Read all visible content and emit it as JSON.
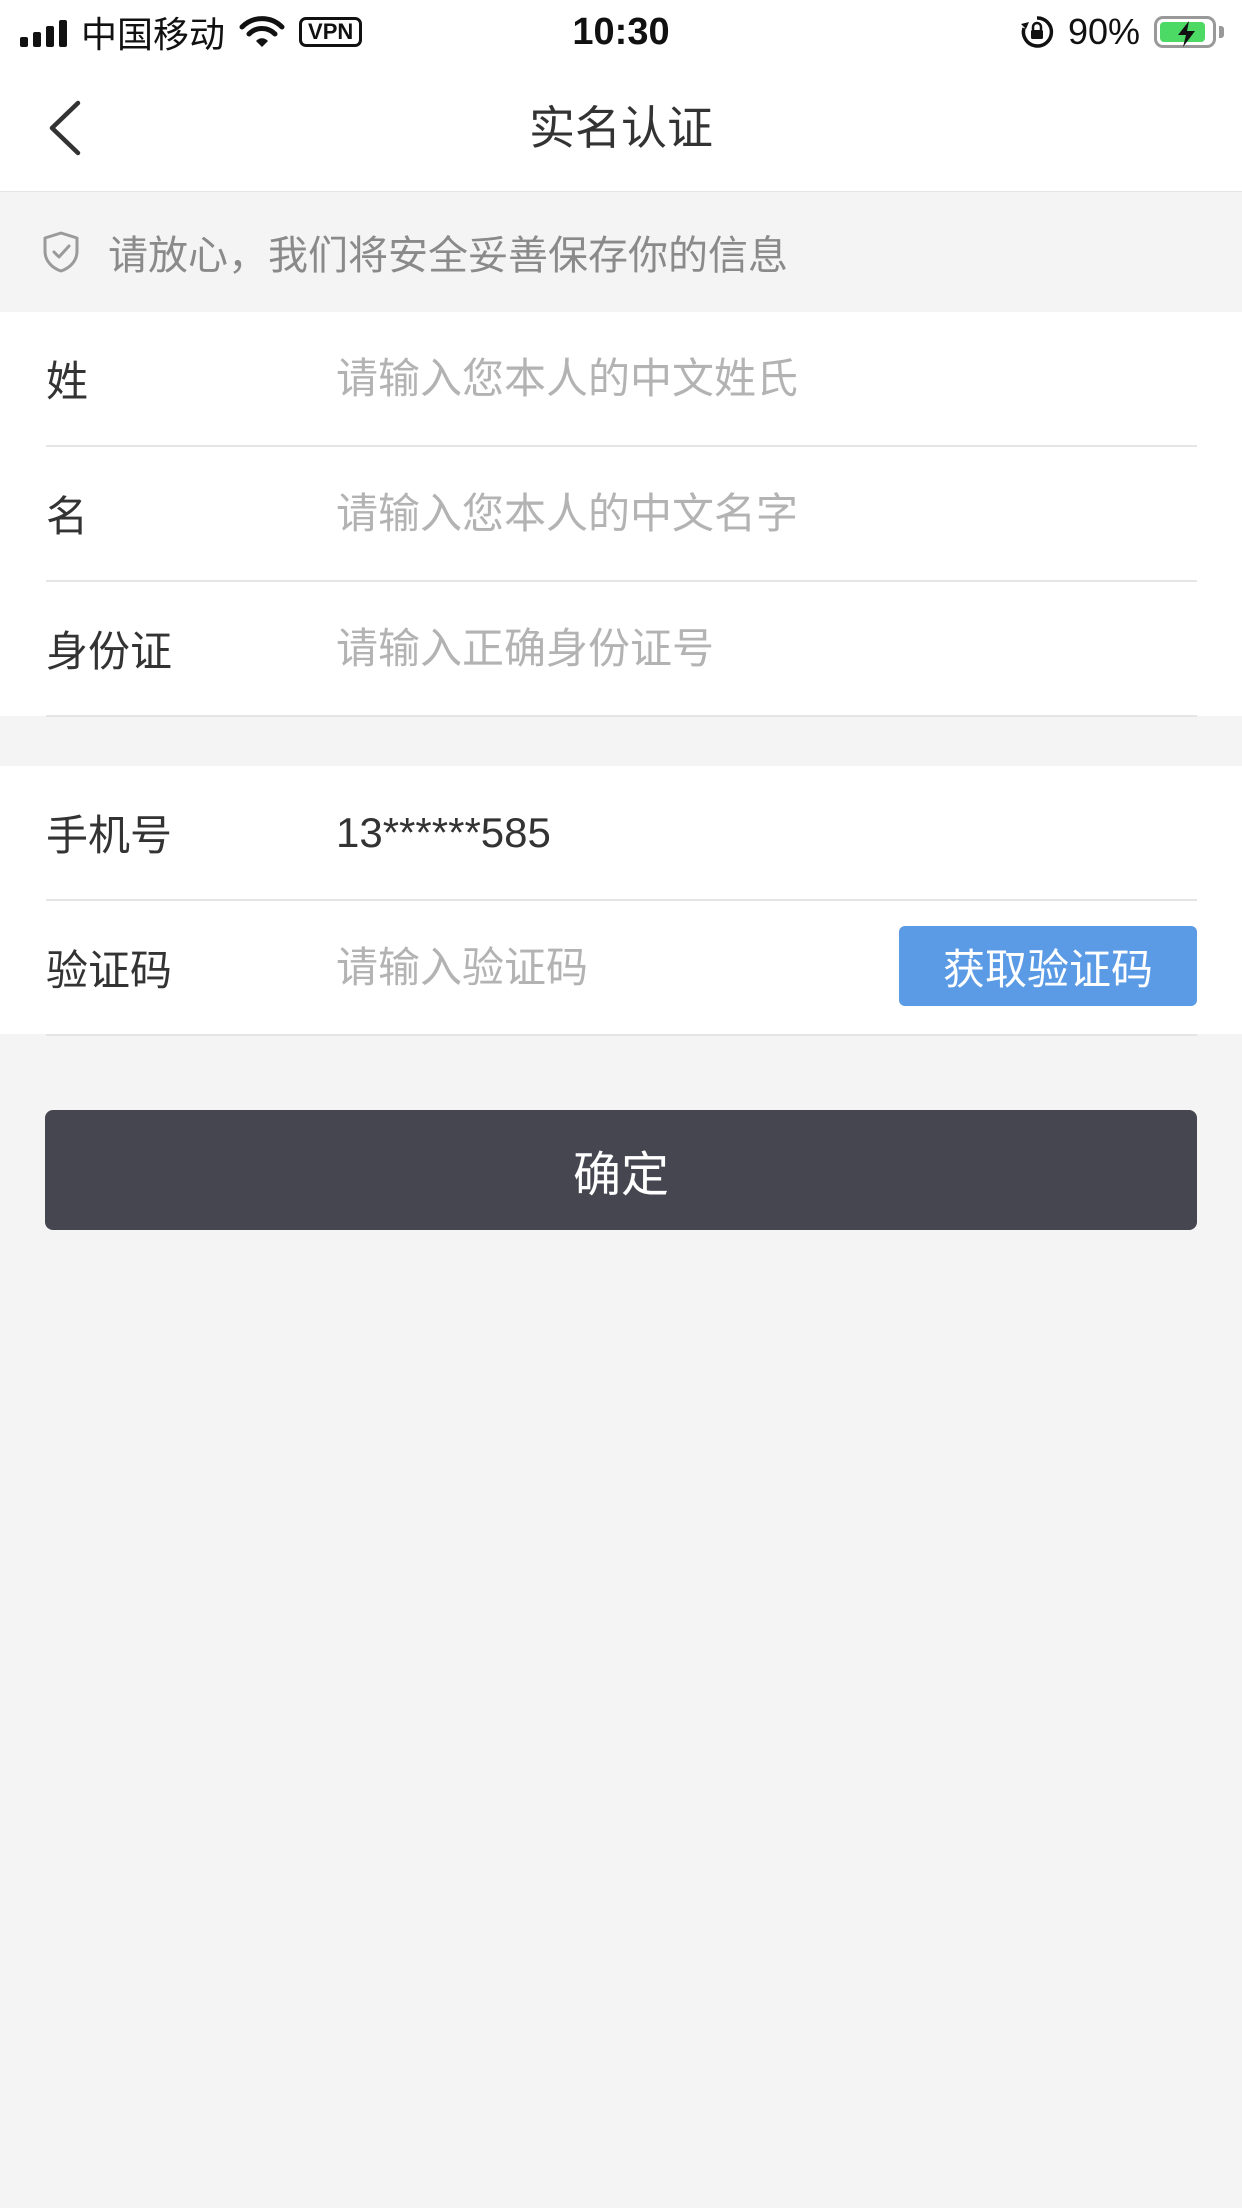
{
  "status_bar": {
    "carrier": "中国移动",
    "vpn": "VPN",
    "time": "10:30",
    "battery": "90%",
    "battery_level": 0.9,
    "battery_color": "#4cd964"
  },
  "nav": {
    "title": "实名认证",
    "back_icon": "chevron-left-icon"
  },
  "notice": {
    "icon": "shield-check-icon",
    "text": "请放心，我们将安全妥善保存你的信息"
  },
  "form": {
    "surname": {
      "label": "姓",
      "placeholder": "请输入您本人的中文姓氏",
      "value": ""
    },
    "given_name": {
      "label": "名",
      "placeholder": "请输入您本人的中文名字",
      "value": ""
    },
    "id_card": {
      "label": "身份证",
      "placeholder": "请输入正确身份证号",
      "value": ""
    },
    "phone": {
      "label": "手机号",
      "value": "13******585"
    },
    "code": {
      "label": "验证码",
      "placeholder": "请输入验证码",
      "value": "",
      "button": "获取验证码"
    }
  },
  "confirm_button": "确定",
  "colors": {
    "accent_blue": "#5b9be6",
    "primary_dark": "#464650",
    "background": "#f4f4f4"
  }
}
